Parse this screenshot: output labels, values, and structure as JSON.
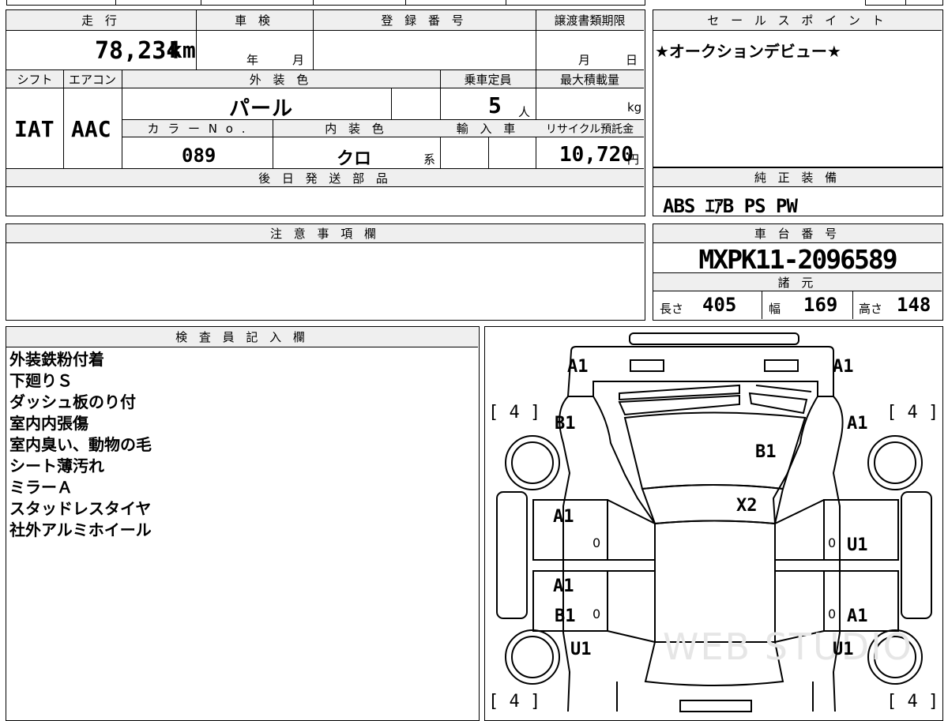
{
  "top": {
    "mileage_label": "走 行",
    "mileage_value": "78,234",
    "mileage_unit": "km",
    "inspection_label": "車 検",
    "inspection_year": "年",
    "inspection_month": "月",
    "registration_label": "登 録 番 号",
    "registration_value": "",
    "transfer_label": "譲渡書類期限",
    "transfer_month": "月",
    "transfer_day": "日",
    "shift_label": "シフト",
    "shift_value": "IAT",
    "ac_label": "エアコン",
    "ac_value": "AAC",
    "exterior_color_label": "外 装 色",
    "exterior_color_value": "パ ー ル",
    "capacity_label": "乗車定員",
    "capacity_value": "5",
    "capacity_unit": "人",
    "max_load_label": "最大積載量",
    "max_load_unit": "kg",
    "color_no_label": "カ ラ ー N o .",
    "color_no_value": "089",
    "interior_color_label": "内 装 色",
    "interior_color_value": "クロ",
    "interior_color_suffix": "系",
    "import_label": "輸 入 車",
    "recycle_label": "リサイクル預託金",
    "recycle_value": "10,720",
    "recycle_unit": "円",
    "later_parts_label": "後 日 発 送 部 品"
  },
  "sales": {
    "label": "セ ー ル ス ポ イ ン ト",
    "value": "★オークションデビュー★"
  },
  "equipment": {
    "label": "純 正 装 備",
    "value": "ABS  ｴｱB  PS  PW"
  },
  "caution": {
    "label": "注 意 事 項 欄"
  },
  "chassis": {
    "label": "車 台 番 号",
    "value": "MXPK11-2096589",
    "specs_label": "諸 元",
    "length_label": "長さ",
    "length_value": "405",
    "width_label": "幅",
    "width_value": "169",
    "height_label": "高さ",
    "height_value": "148"
  },
  "inspector": {
    "label": "検 査 員 記 入 欄",
    "notes": [
      "外装鉄粉付着",
      "下廻りＳ",
      "ダッシュ板のり付",
      "室内内張傷",
      "室内臭い、動物の毛",
      "シート薄汚れ",
      "ミラーＡ",
      "スタッドレスタイヤ",
      "社外アルミホイール"
    ]
  },
  "diagram": {
    "marks": {
      "front_left": "A1",
      "front_right": "A1",
      "fender_left": "B1",
      "fender_right": "A1",
      "hood": "B1",
      "windshield": "X2",
      "front_door_left": "A1",
      "front_door_right": "U1",
      "rear_door_left_1": "A1",
      "rear_door_left_2": "B1",
      "rear_door_right": "A1",
      "quarter_left": "U1",
      "quarter_right": "U1",
      "zero_1": "0",
      "zero_2": "0",
      "zero_3": "0",
      "zero_4": "0"
    },
    "tires": {
      "front_left": "[ 4 ]",
      "front_right": "[ 4 ]",
      "rear_left": "[ 4 ]",
      "rear_right": "[ 4 ]"
    },
    "watermark": "WEB STUDIO"
  }
}
